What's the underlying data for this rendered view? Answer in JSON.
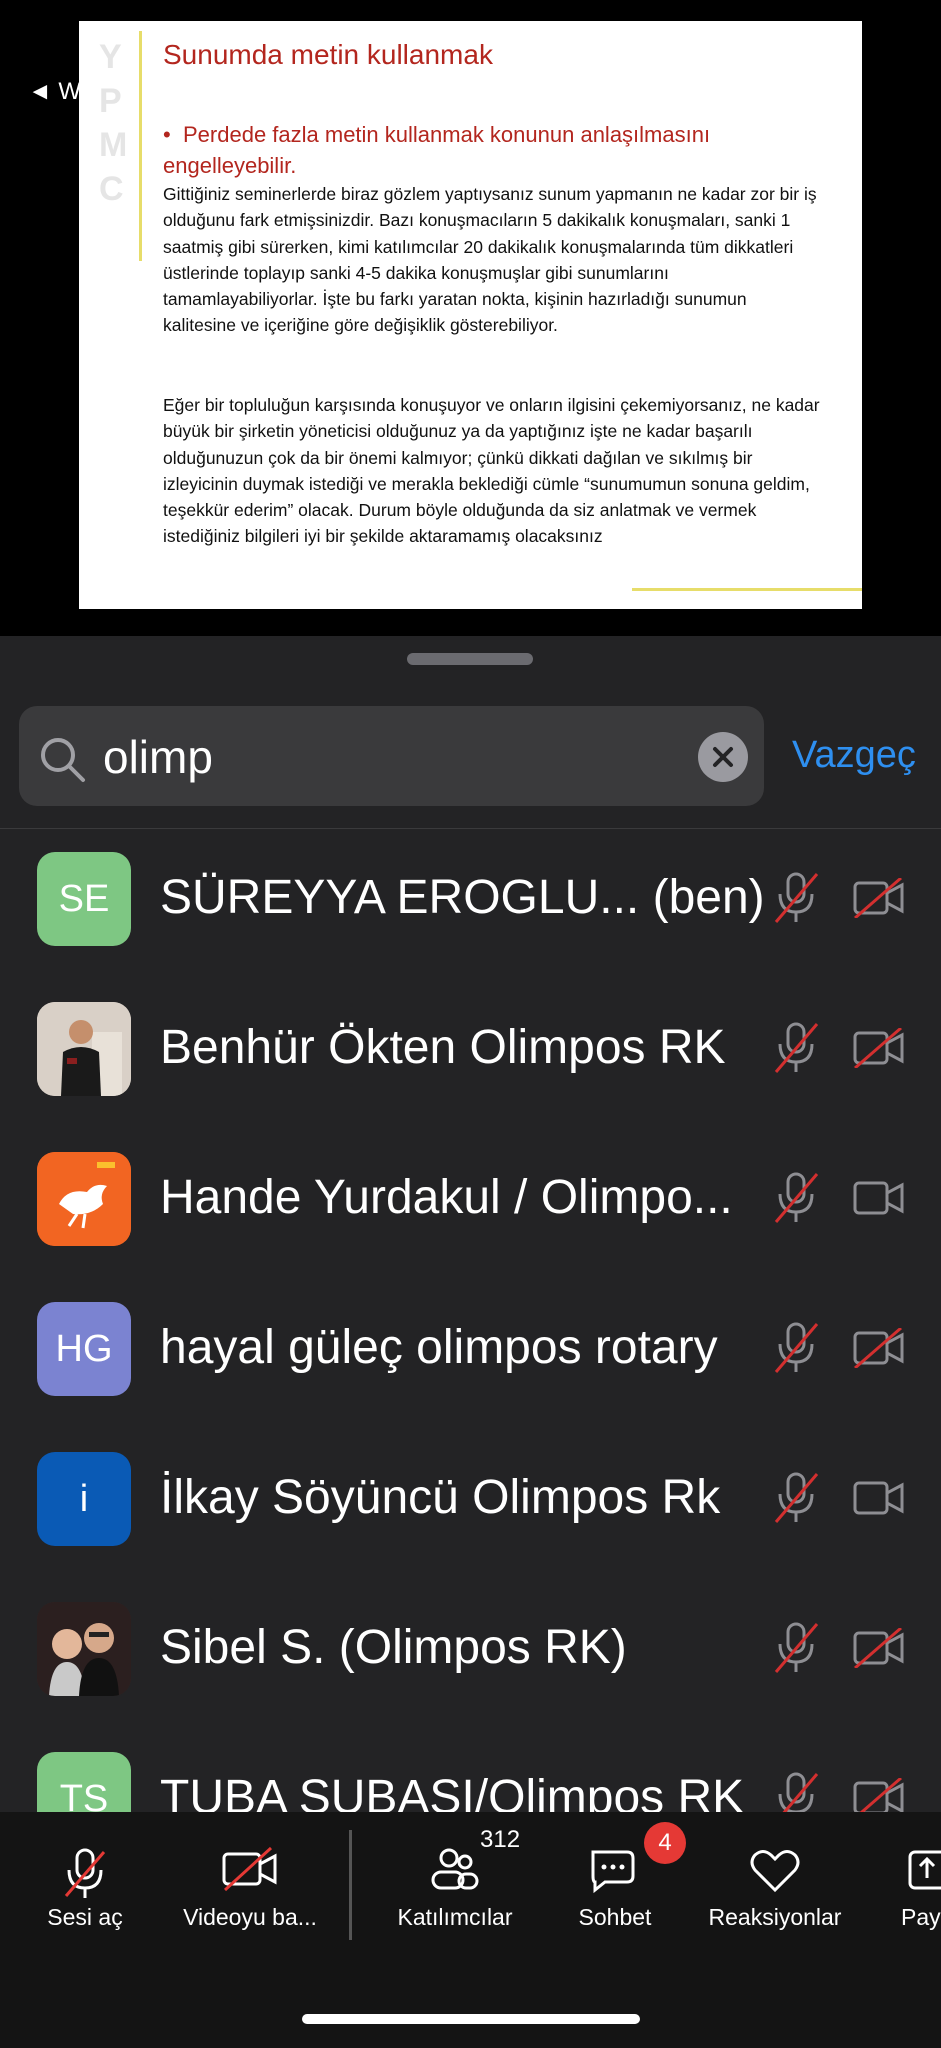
{
  "share": {
    "back_label": "◄ W",
    "side_letters": "Y\nP\nM\nC",
    "slide_title": "Sunumda metin kullanmak",
    "bullet": "Perdede fazla metin kullanmak konunun anlaşılmasını engelleyebilir.",
    "para1": "Gittiğiniz seminerlerde biraz gözlem yaptıysanız sunum yapmanın ne kadar zor bir iş olduğunu fark etmişsinizdir. Bazı konuşmacıların 5 dakikalık konuşmaları, sanki 1 saatmiş gibi sürerken, kimi katılımcılar 20 dakikalık konuşmalarında tüm dikkatleri üstlerinde toplayıp sanki 4-5 dakika konuşmuşlar gibi sunumlarını tamamlayabiliyorlar. İşte bu farkı yaratan nokta, kişinin hazırladığı sunumun kalitesine ve içeriğine göre değişiklik gösterebiliyor.",
    "para2": "Eğer bir topluluğun karşısında konuşuyor ve onların ilgisini çekemiyorsanız, ne kadar büyük bir şirketin yöneticisi olduğunuz ya da yaptığınız işte ne kadar başarılı olduğunuzun çok da bir önemi kalmıyor; çünkü dikkati dağılan ve sıkılmış bir izleyicinin duymak istediği ve merakla beklediği cümle “sunumumun sonuna geldim, teşekkür ederim” olacak. Durum böyle olduğunda da siz anlatmak ve vermek istediğiniz bilgileri iyi bir şekilde aktaramamış olacaksınız"
  },
  "search": {
    "value": "olimp",
    "cancel_label": "Vazgeç"
  },
  "participants": [
    {
      "initials": "SE",
      "avatar_color": "#7ec783",
      "name": "SÜREYYA EROGLU... (ben)",
      "mic_muted": true,
      "cam_off": true
    },
    {
      "initials": "",
      "avatar_color": "#d8cfc6",
      "name": "Benhür Ökten Olimpos RK",
      "mic_muted": true,
      "cam_off": true
    },
    {
      "initials": "",
      "avatar_color": "#f26522",
      "name": "Hande Yurdakul / Olimpo...",
      "mic_muted": true,
      "cam_off": false
    },
    {
      "initials": "HG",
      "avatar_color": "#7b83d1",
      "name": "hayal güleç olimpos rotary",
      "mic_muted": true,
      "cam_off": true
    },
    {
      "initials": "i",
      "avatar_color": "#0a5ab5",
      "name": "İlkay Söyüncü Olimpos Rk",
      "mic_muted": true,
      "cam_off": false
    },
    {
      "initials": "",
      "avatar_color": "#3b2a2a",
      "name": "Sibel S. (Olimpos RK)",
      "mic_muted": true,
      "cam_off": true
    },
    {
      "initials": "TS",
      "avatar_color": "#7ec783",
      "name": "TUBA SUBASI/Olimpos RK",
      "mic_muted": true,
      "cam_off": true
    }
  ],
  "toolbar": {
    "audio_label": "Sesi aç",
    "video_label": "Videoyu ba...",
    "participants_label": "Katılımcılar",
    "participants_count": "312",
    "chat_label": "Sohbet",
    "chat_badge": "4",
    "reactions_label": "Reaksiyonlar",
    "share_label": "Pay"
  }
}
